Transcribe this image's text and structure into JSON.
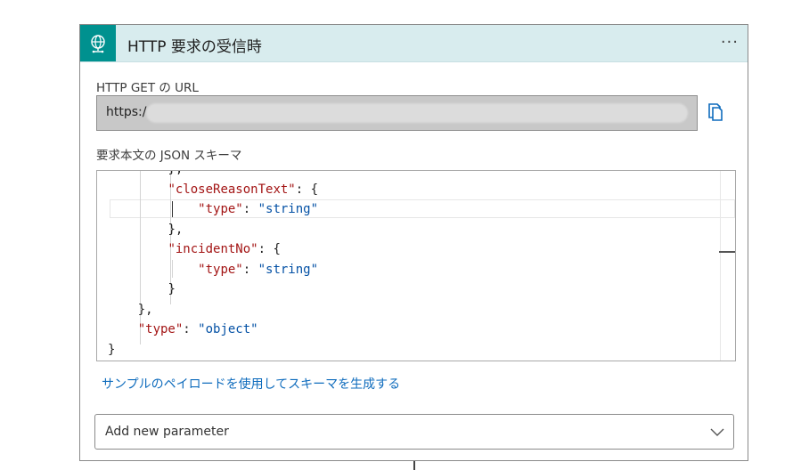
{
  "header": {
    "title": "HTTP 要求の受信時",
    "icon": "globe-network-icon",
    "menu_icon": "more-options-icon",
    "accent_color": "#00918f",
    "header_background": "#d8ecee"
  },
  "url_field": {
    "label": "HTTP GET の URL",
    "value_visible": "https:/",
    "copy_icon": "copy-icon"
  },
  "schema": {
    "label": "要求本文の JSON スキーマ",
    "key_color": "#a31515",
    "string_color": "#0451a5",
    "lines": [
      {
        "indent": "        ",
        "parts": [
          {
            "t": "p",
            "v": "},"
          }
        ]
      },
      {
        "indent": "        ",
        "parts": [
          {
            "t": "k",
            "v": "\"closeReasonText\""
          },
          {
            "t": "p",
            "v": ": {"
          }
        ]
      },
      {
        "indent": "            ",
        "parts": [
          {
            "t": "k",
            "v": "\"type\""
          },
          {
            "t": "p",
            "v": ": "
          },
          {
            "t": "s",
            "v": "\"string\""
          }
        ]
      },
      {
        "indent": "        ",
        "parts": [
          {
            "t": "p",
            "v": "},"
          }
        ]
      },
      {
        "indent": "        ",
        "parts": [
          {
            "t": "k",
            "v": "\"incidentNo\""
          },
          {
            "t": "p",
            "v": ": {"
          }
        ]
      },
      {
        "indent": "            ",
        "parts": [
          {
            "t": "k",
            "v": "\"type\""
          },
          {
            "t": "p",
            "v": ": "
          },
          {
            "t": "s",
            "v": "\"string\""
          }
        ]
      },
      {
        "indent": "        ",
        "parts": [
          {
            "t": "p",
            "v": "}"
          }
        ]
      },
      {
        "indent": "    ",
        "parts": [
          {
            "t": "p",
            "v": "},"
          }
        ]
      },
      {
        "indent": "    ",
        "parts": [
          {
            "t": "k",
            "v": "\"type\""
          },
          {
            "t": "p",
            "v": ": "
          },
          {
            "t": "s",
            "v": "\"object\""
          }
        ]
      },
      {
        "indent": "",
        "parts": [
          {
            "t": "p",
            "v": "}"
          }
        ]
      }
    ]
  },
  "sample_link": "サンプルのペイロードを使用してスキーマを生成する",
  "add_parameter": {
    "placeholder": "Add new parameter",
    "icon": "chevron-down-icon"
  }
}
